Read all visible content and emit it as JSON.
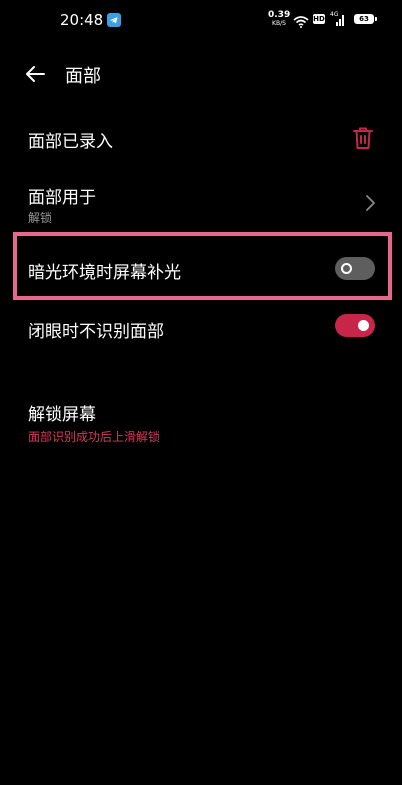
{
  "status_bar": {
    "time": "20:48",
    "net_speed_value": "0.39",
    "net_speed_unit": "KB/S",
    "hd_label": "HD",
    "network_label": "4G",
    "battery_level": "63",
    "icons": [
      "telegram-icon",
      "wifi-icon",
      "hd-icon",
      "signal-icon",
      "battery-icon"
    ]
  },
  "header": {
    "title": "面部",
    "back_icon": "arrow-left-icon"
  },
  "settings": {
    "face_enrolled": {
      "label": "面部已录入",
      "icon": "trash-icon"
    },
    "face_used_for": {
      "label": "面部用于",
      "value": "解锁",
      "icon": "chevron-right-icon"
    },
    "low_light_fill": {
      "label": "暗光环境时屏幕补光",
      "enabled": false
    },
    "no_recognize_eyes_closed": {
      "label": "闭眼时不识别面部",
      "enabled": true
    },
    "unlock_screen": {
      "label": "解锁屏幕",
      "value": "面部识别成功后上滑解锁"
    }
  },
  "colors": {
    "background": "#000000",
    "accent": "#c7254a",
    "accent_text": "#d23a5e",
    "highlight_border": "#e8678f",
    "toggle_off": "#5e5e5e",
    "secondary_text": "#9a9a9a"
  }
}
